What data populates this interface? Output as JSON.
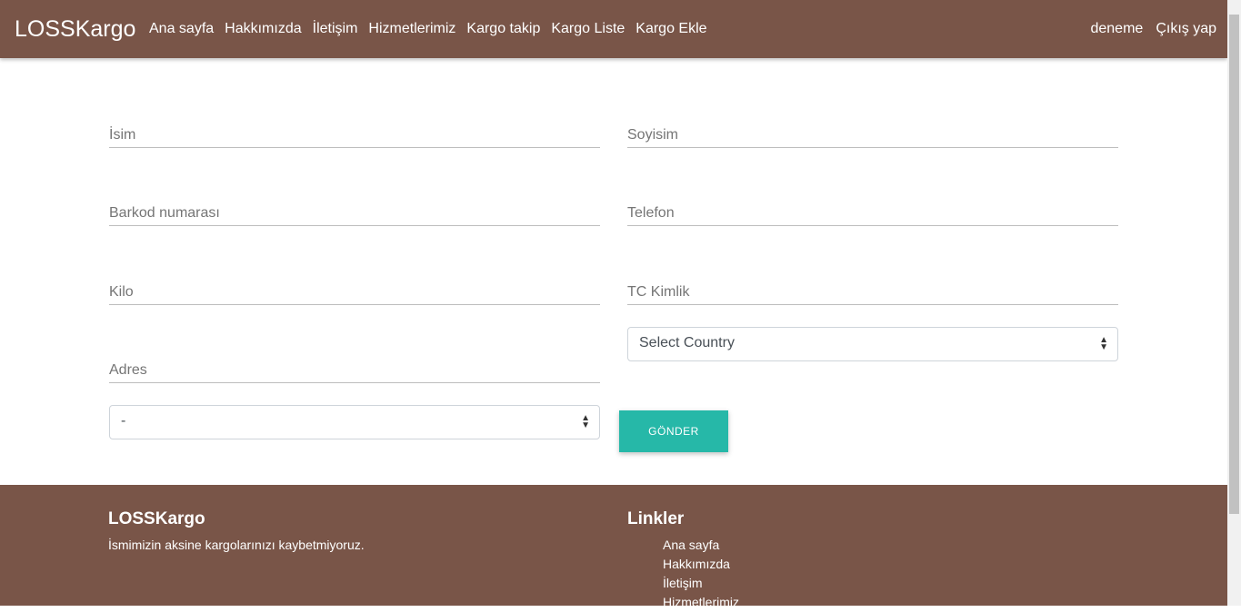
{
  "nav": {
    "brand": "LOSSKargo",
    "links": [
      "Ana sayfa",
      "Hakkımızda",
      "İletişim",
      "Hizmetlerimiz",
      "Kargo takip",
      "Kargo Liste",
      "Kargo Ekle"
    ],
    "right": [
      "deneme",
      "Çıkış yap"
    ]
  },
  "form": {
    "isim": "İsim",
    "soyisim": "Soyisim",
    "barkod": "Barkod numarası",
    "telefon": "Telefon",
    "kilo": "Kilo",
    "tc": "TC Kimlik",
    "country": "Select Country",
    "adres": "Adres",
    "city": "-",
    "submit": "GÖNDER"
  },
  "footer": {
    "brand": "LOSSKargo",
    "slogan": "İsmimizin aksine kargolarınızı kaybetmiyoruz.",
    "links_title": "Linkler",
    "links": [
      "Ana sayfa",
      "Hakkımızda",
      "İletişim",
      "Hizmetlerimiz"
    ]
  },
  "colors": {
    "brand": "#795548",
    "accent": "#26b8a8"
  }
}
